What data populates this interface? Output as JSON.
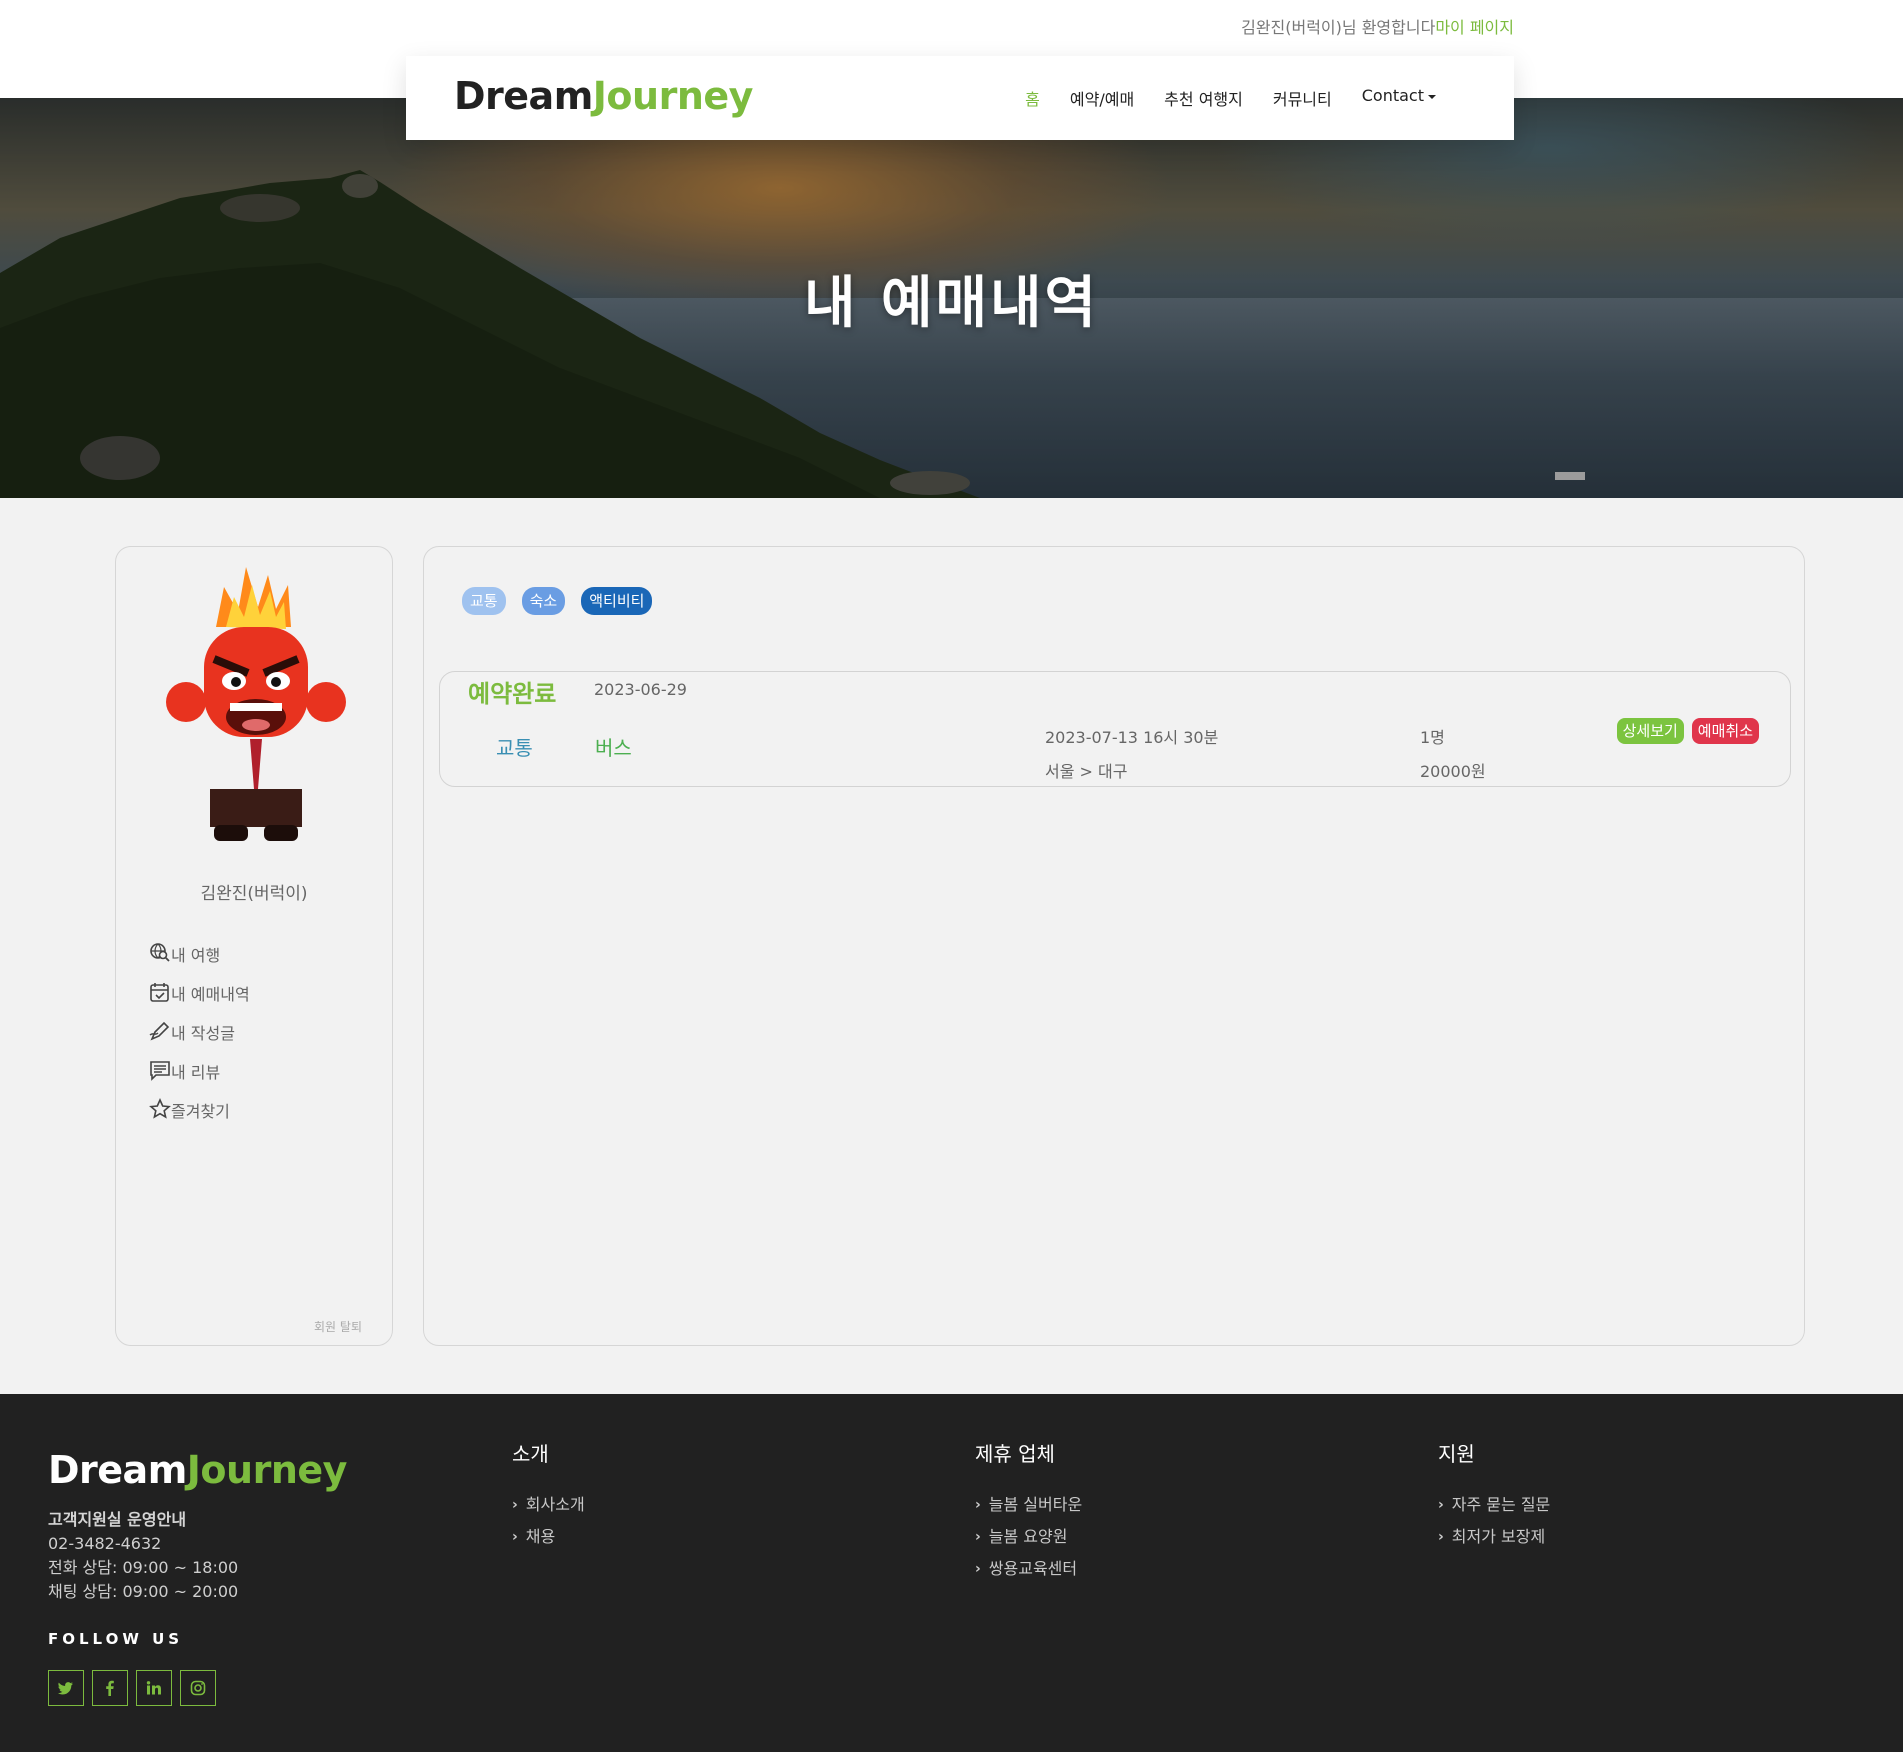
{
  "header": {
    "welcome_text": "김완진(버럭이)님 환영합니다",
    "mypage_link": "마이 페이지",
    "brand_part1": "Dream",
    "brand_part2": "Journey",
    "nav": [
      "홈",
      "예약/예매",
      "추천 여행지",
      "커뮤니티",
      "Contact"
    ],
    "active_nav": "홈"
  },
  "hero": {
    "title": "내 예매내역"
  },
  "sidebar": {
    "username": "김완진(버럭이)",
    "items": [
      {
        "label": "내 여행",
        "icon": "search-globe-icon"
      },
      {
        "label": "내 예매내역",
        "icon": "calendar-check-icon"
      },
      {
        "label": "내 작성글",
        "icon": "pencil-icon"
      },
      {
        "label": "내 리뷰",
        "icon": "comment-icon"
      },
      {
        "label": "즐겨찾기",
        "icon": "star-icon"
      }
    ],
    "withdraw": "회원 탈퇴"
  },
  "filters": [
    "교통",
    "숙소",
    "액티비티"
  ],
  "booking": {
    "status": "예약완료",
    "booked_date": "2023-06-29",
    "category": "교통",
    "type": "버스",
    "datetime": "2023-07-13 16시 30분",
    "route": "서울 > 대구",
    "count": "1명",
    "price": "20000원",
    "detail_button": "상세보기",
    "cancel_button": "예매취소"
  },
  "footer": {
    "brand_part1": "Dream",
    "brand_part2": "Journey",
    "support_heading": "고객지원실 운영안내",
    "phone": "02-3482-4632",
    "call_hours": "전화 상담: 09:00 ~ 18:00",
    "chat_hours": "채팅 상담: 09:00 ~ 20:00",
    "follow_us": "FOLLOW US",
    "socials": [
      "twitter-icon",
      "facebook-icon",
      "linkedin-icon",
      "instagram-icon"
    ],
    "columns": [
      {
        "title": "소개",
        "links": [
          "회사소개",
          "채용"
        ]
      },
      {
        "title": "제휴 업체",
        "links": [
          "늘봄 실버타운",
          "늘봄 요양원",
          "쌍용교육센터"
        ]
      },
      {
        "title": "지원",
        "links": [
          "자주 묻는 질문",
          "최저가 보장제"
        ]
      }
    ]
  },
  "colors": {
    "accent": "#7cbb3e",
    "footer_bg": "#212121",
    "cancel": "#e0354b",
    "pill_dark": "#1a67b7"
  }
}
